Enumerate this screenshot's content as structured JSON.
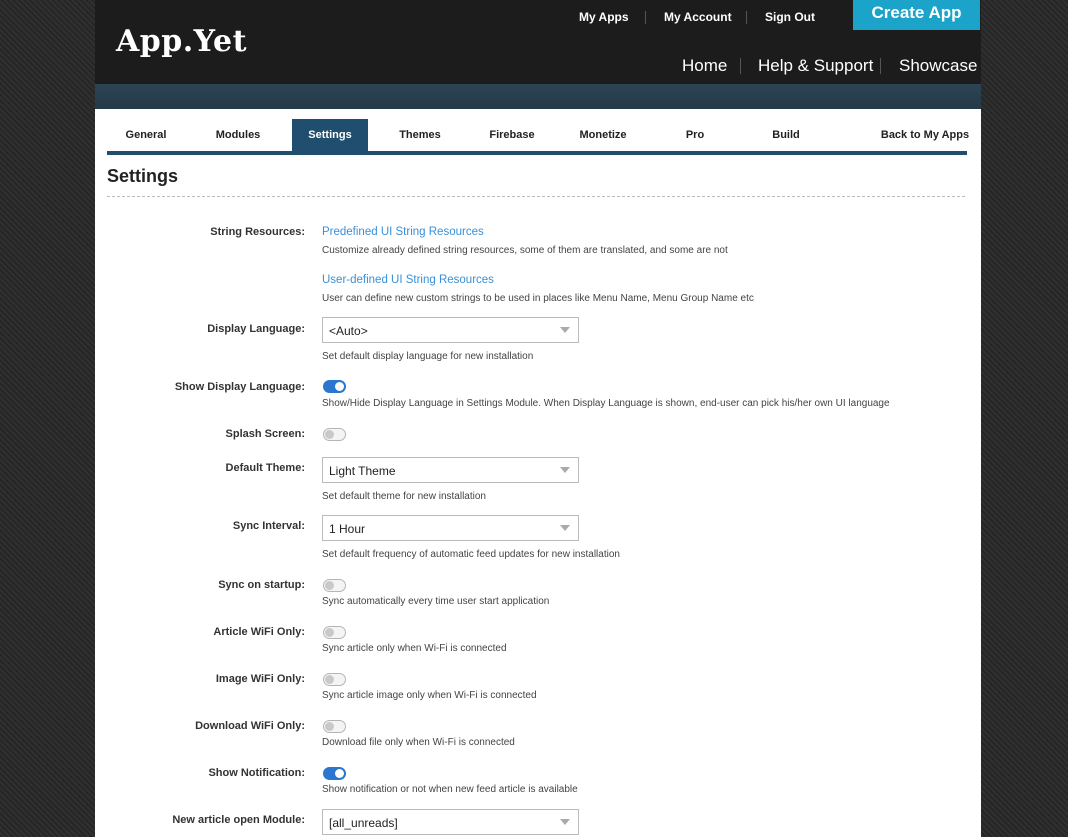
{
  "header": {
    "logo": "App.Yet",
    "top_links": [
      "My Apps",
      "My Account",
      "Sign Out"
    ],
    "create_button": "Create App",
    "main_links": [
      "Home",
      "Help & Support",
      "Showcase"
    ],
    "accent_color": "#1ba3c9"
  },
  "tabs": [
    {
      "label": "General"
    },
    {
      "label": "Modules"
    },
    {
      "label": "Settings"
    },
    {
      "label": "Themes"
    },
    {
      "label": "Firebase"
    },
    {
      "label": "Monetize"
    },
    {
      "label": "Pro"
    },
    {
      "label": "Build"
    },
    {
      "label": "Back to My Apps"
    }
  ],
  "active_tab": "Settings",
  "page_title": "Settings",
  "fields": {
    "string_resources": {
      "label": "String Resources:",
      "predefined_link": "Predefined UI String Resources",
      "predefined_help": "Customize already defined string resources, some of them are translated, and some are not",
      "user_link": "User-defined UI String Resources",
      "user_help": "User can define new custom strings to be used in places like Menu Name, Menu Group Name etc"
    },
    "display_language": {
      "label": "Display Language:",
      "value": "<Auto>",
      "help": "Set default display language for new installation"
    },
    "show_display_language": {
      "label": "Show Display Language:",
      "on": true,
      "help": "Show/Hide Display Language in Settings Module. When Display Language is shown, end-user can pick his/her own UI language"
    },
    "splash_screen": {
      "label": "Splash Screen:",
      "on": false
    },
    "default_theme": {
      "label": "Default Theme:",
      "value": "Light Theme",
      "help": "Set default theme for new installation"
    },
    "sync_interval": {
      "label": "Sync Interval:",
      "value": "1 Hour",
      "help": "Set default frequency of automatic feed updates for new installation"
    },
    "sync_on_startup": {
      "label": "Sync on startup:",
      "on": false,
      "help": "Sync automatically every time user start application"
    },
    "article_wifi_only": {
      "label": "Article WiFi Only:",
      "on": false,
      "help": "Sync article only when Wi-Fi is connected"
    },
    "image_wifi_only": {
      "label": "Image WiFi Only:",
      "on": false,
      "help": "Sync article image only when Wi-Fi is connected"
    },
    "download_wifi_only": {
      "label": "Download WiFi Only:",
      "on": false,
      "help": "Download file only when Wi-Fi is connected"
    },
    "show_notification": {
      "label": "Show Notification:",
      "on": true,
      "help": "Show notification or not when new feed article is available"
    },
    "new_article_open_module": {
      "label": "New article open Module:",
      "value": "[all_unreads]"
    }
  }
}
